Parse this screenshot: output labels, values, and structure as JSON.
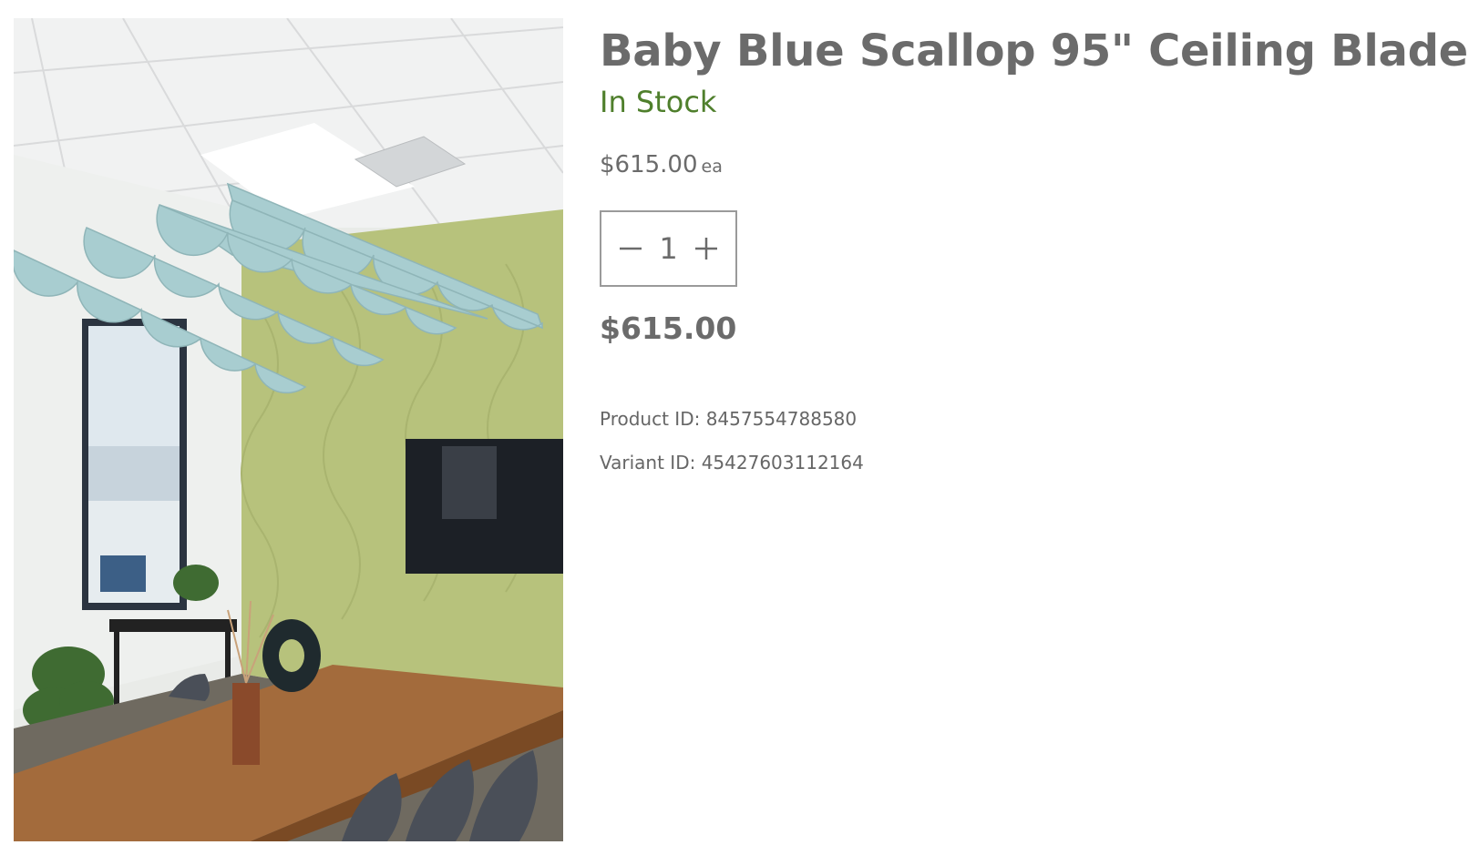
{
  "product": {
    "title": "Baby Blue Scallop 95\" Ceiling Blade",
    "stock_status": "In Stock",
    "unit_price": "$615.00",
    "unit_label": "ea",
    "quantity": "1",
    "total_price": "$615.00",
    "product_id_label": "Product ID:",
    "product_id": "8457554788580",
    "variant_id_label": "Variant ID:",
    "variant_id": "45427603112164"
  },
  "colors": {
    "text": "#6b6b6b",
    "stock": "#4f7f2c",
    "blade": "#a8cdd0",
    "wall": "#b7c27c"
  },
  "icons": {
    "decrement": "minus-icon",
    "increment": "plus-icon"
  }
}
